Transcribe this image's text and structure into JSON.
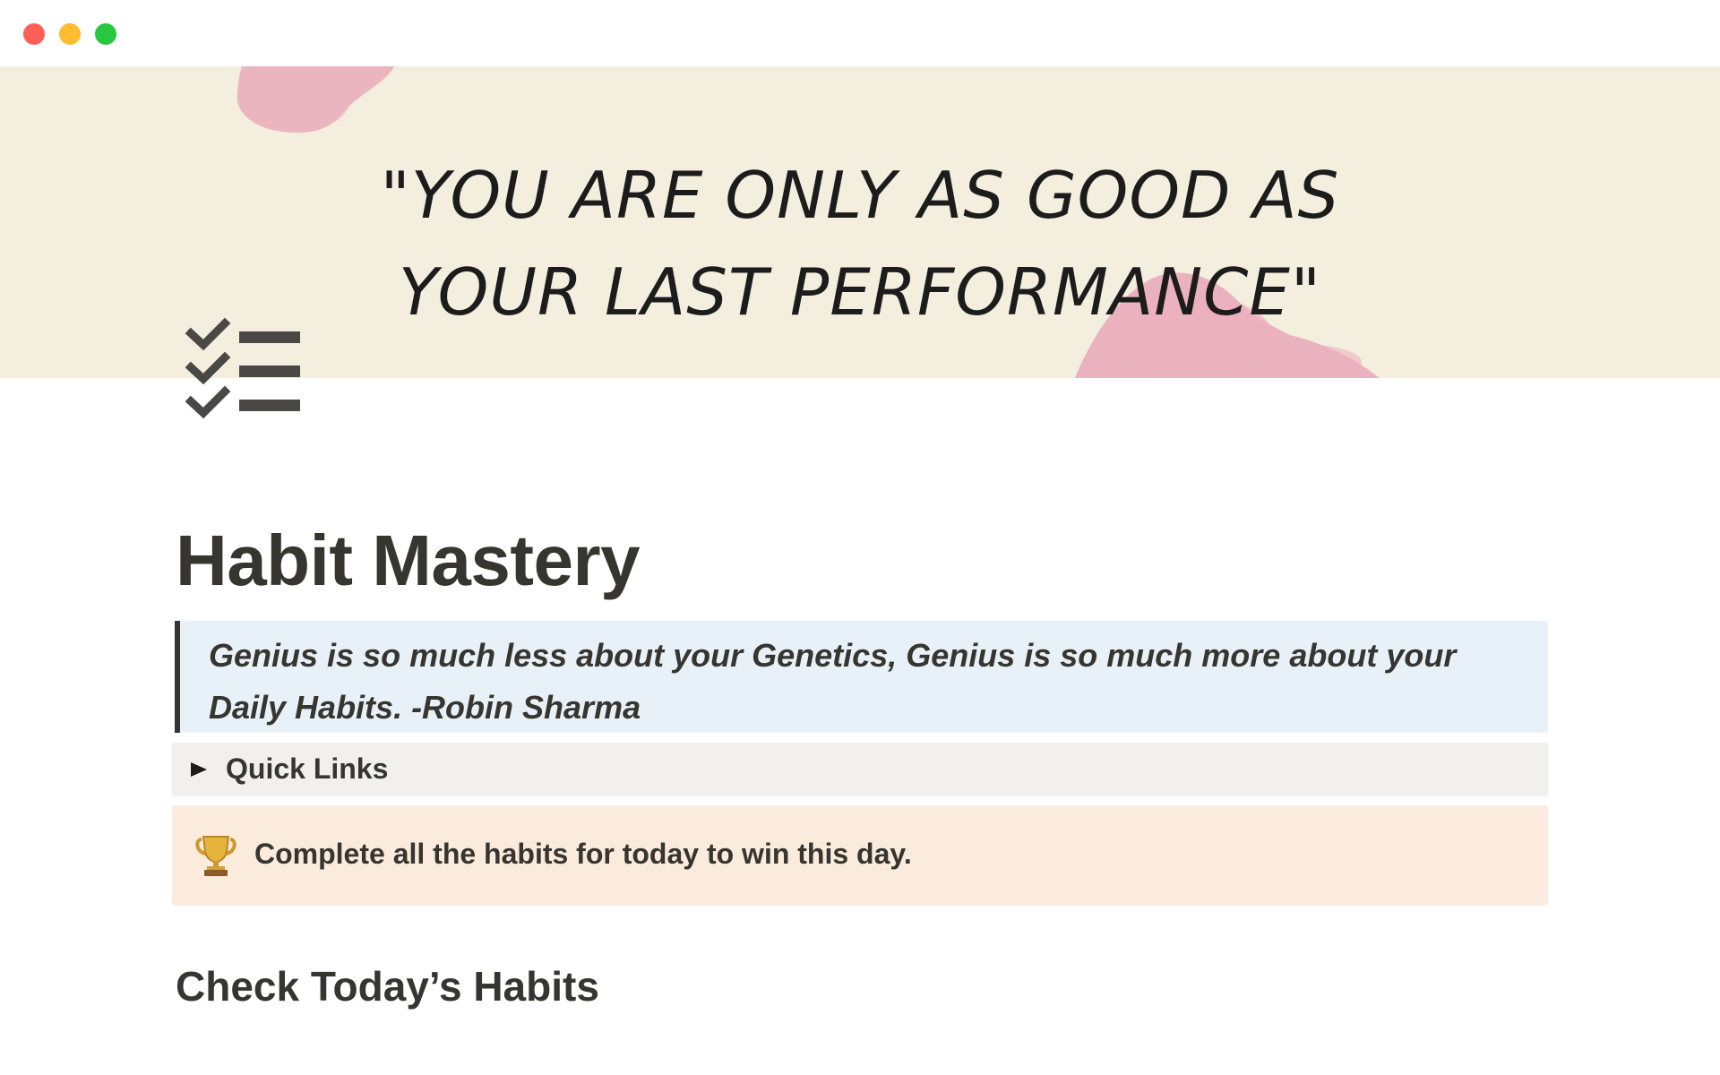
{
  "window": {
    "controls": [
      "close",
      "minimize",
      "zoom"
    ]
  },
  "cover": {
    "quote_line1": "\"YOU ARE ONLY AS GOOD AS",
    "quote_line2": "YOUR LAST PERFORMANCE\"",
    "background_color": "#f3eedd",
    "accent_color": "#e9a3b7"
  },
  "page": {
    "icon": "checklist-icon",
    "title": "Habit Mastery"
  },
  "quote": {
    "text": "Genius is so much less about your Genetics, Genius is so much more about your Daily Habits.   -Robin Sharma"
  },
  "toggle": {
    "icon": "triangle-right-icon",
    "label": "Quick Links"
  },
  "callout": {
    "icon": "trophy-icon",
    "text": "Complete all the habits for today to win this day."
  },
  "section": {
    "heading": "Check Today’s Habits"
  }
}
